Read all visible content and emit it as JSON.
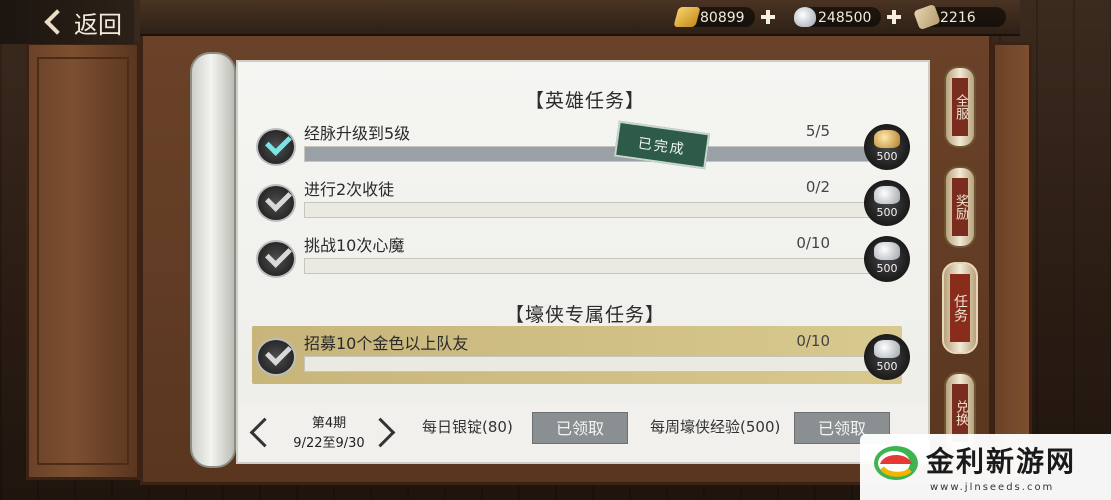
{
  "header": {
    "back_label": "返回",
    "resources": [
      {
        "icon": "gold-ingot-icon",
        "value": "80899"
      },
      {
        "icon": "silver-ingot-icon",
        "value": "248500"
      },
      {
        "icon": "scroll-icon",
        "value": "2216"
      }
    ]
  },
  "hero_tasks": {
    "title": "【英雄任务】",
    "completed_stamp": "已完成",
    "items": [
      {
        "name": "经脉升级到5级",
        "progress": "5/5",
        "fill": 1.0,
        "reward": "500",
        "done": true
      },
      {
        "name": "进行2次收徒",
        "progress": "0/2",
        "fill": 0.0,
        "reward": "500",
        "done": false
      },
      {
        "name": "挑战10次心魔",
        "progress": "0/10",
        "fill": 0.0,
        "reward": "500",
        "done": false
      }
    ]
  },
  "hero_exclusive": {
    "title": "【壕侠专属任务】",
    "items": [
      {
        "name": "招募10个金色以上队友",
        "progress": "0/10",
        "fill": 0.0,
        "reward": "500",
        "done": false
      }
    ]
  },
  "footer": {
    "period": "第4期",
    "date_range": "9/22至9/30",
    "daily_label": "每日银锭(80)",
    "daily_button": "已领取",
    "weekly_label": "每周壕侠经验(500)",
    "weekly_button": "已领取"
  },
  "side_tabs": [
    "全服",
    "奖励",
    "任务",
    "兑换"
  ],
  "watermark": {
    "text": "金利新游网",
    "url": "www.jlnseeds.com"
  },
  "colors": {
    "highlight_row": "#d1c187",
    "stamp": "#2e5a49",
    "tab_active": "#8a2c1c"
  }
}
